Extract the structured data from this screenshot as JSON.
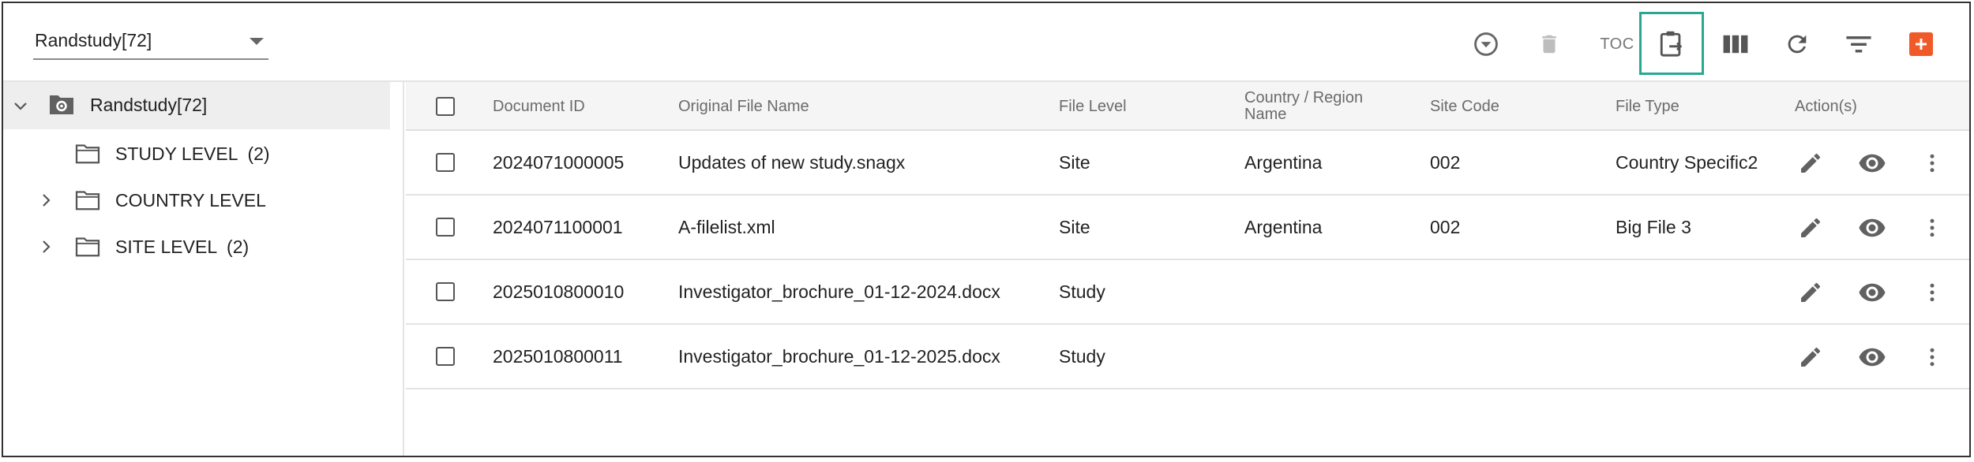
{
  "study_selector": {
    "value": "Randstudy[72]"
  },
  "toolbar": {
    "toc_label": "TOC",
    "icons": [
      "chevron-circle-down-icon",
      "trash-icon",
      "toc",
      "clipboard-export-icon",
      "columns-icon",
      "refresh-icon",
      "filter-icon",
      "add-icon"
    ],
    "accent_color": "#f05a28",
    "highlight_color": "#2aa793"
  },
  "tree": {
    "root": {
      "label": "Randstudy[72]",
      "icon": "folder-gear-icon"
    },
    "items": [
      {
        "label": "STUDY LEVEL  (2)",
        "expandable": false
      },
      {
        "label": "COUNTRY LEVEL",
        "expandable": true
      },
      {
        "label": "SITE LEVEL  (2)",
        "expandable": true
      }
    ]
  },
  "table": {
    "columns": [
      "Document ID",
      "Original File Name",
      "File Level",
      "Country / Region Name",
      "Site Code",
      "File Type",
      "Action(s)"
    ],
    "rows": [
      {
        "document_id": "2024071000005",
        "file_name": "Updates of new study.snagx",
        "file_level": "Site",
        "country": "Argentina",
        "site_code": "002",
        "file_type": "Country Specific2"
      },
      {
        "document_id": "2024071100001",
        "file_name": "A-filelist.xml",
        "file_level": "Site",
        "country": "Argentina",
        "site_code": "002",
        "file_type": "Big File 3"
      },
      {
        "document_id": "2025010800010",
        "file_name": "Investigator_brochure_01-12-2024.docx",
        "file_level": "Study",
        "country": "",
        "site_code": "",
        "file_type": ""
      },
      {
        "document_id": "2025010800011",
        "file_name": "Investigator_brochure_01-12-2025.docx",
        "file_level": "Study",
        "country": "",
        "site_code": "",
        "file_type": ""
      }
    ],
    "row_actions": [
      "edit-icon",
      "view-icon",
      "more-vert-icon"
    ]
  }
}
